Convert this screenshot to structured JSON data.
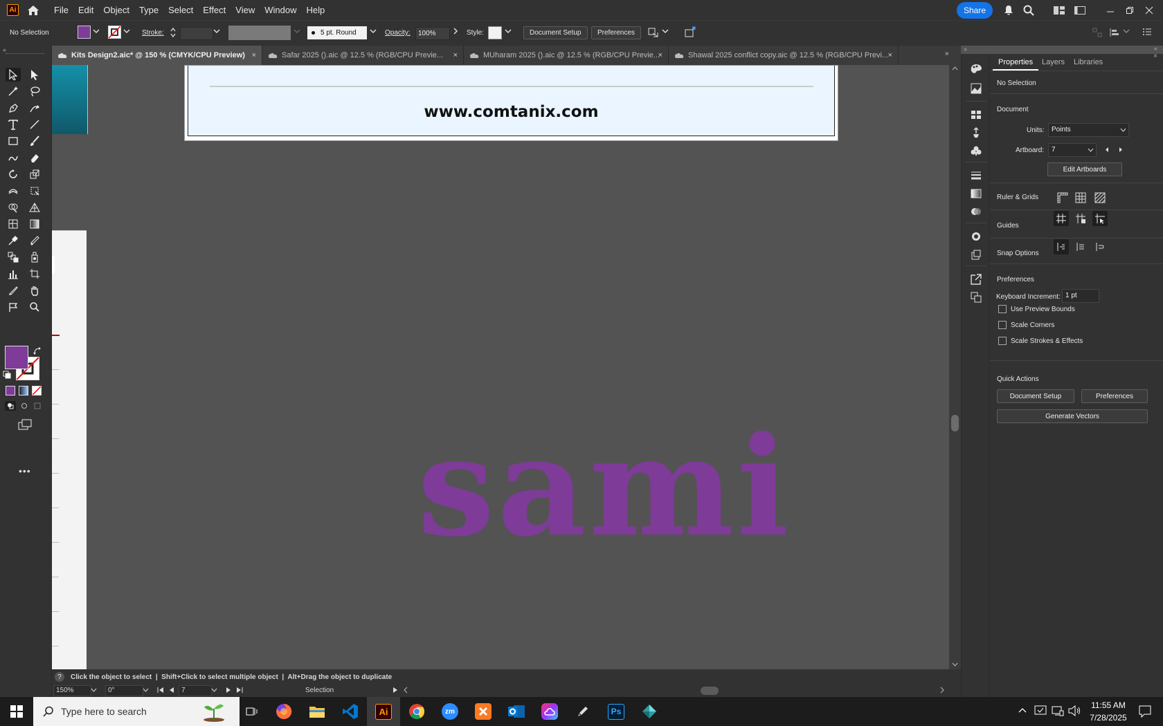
{
  "menubar": {
    "app_badge": "Ai",
    "items": [
      "File",
      "Edit",
      "Object",
      "Type",
      "Select",
      "Effect",
      "View",
      "Window",
      "Help"
    ],
    "share_label": "Share"
  },
  "control": {
    "selection_status": "No Selection",
    "stroke_label": "Stroke:",
    "brush_value": "5 pt. Round",
    "opacity_label": "Opacity:",
    "opacity_value": "100%",
    "style_label": "Style:",
    "document_setup": "Document Setup",
    "preferences": "Preferences",
    "fill_color": "#7e3b98"
  },
  "tabs": [
    {
      "label": "Kits Design2.aic* @ 150 % (CMYK/CPU Preview)",
      "close": "×"
    },
    {
      "label": "Safar 2025 ().aic @ 12.5 % (RGB/CPU Previe...",
      "close": "×"
    },
    {
      "label": "MUharam 2025 ().aic @ 12.5 % (RGB/CPU Previe...",
      "close": "×"
    },
    {
      "label": "Shawal 2025 conflict copy.aic @ 12.5 % (RGB/CPU Previ...",
      "close": "×"
    }
  ],
  "canvas": {
    "website_text": "www.comtanix.com",
    "artwork_text": "sami",
    "artwork_color": "#7e3b98"
  },
  "status": {
    "hint": "Click the object to select  |  Shift+Click to select multiple object  |  Alt+Drag the object to duplicate",
    "zoom": "150%",
    "rotation": "0°",
    "artboard_num": "7",
    "tool_name": "Selection"
  },
  "properties": {
    "tabs": [
      "Properties",
      "Layers",
      "Libraries"
    ],
    "selection": "No Selection",
    "document_heading": "Document",
    "units_label": "Units:",
    "units_value": "Points",
    "artboard_label": "Artboard:",
    "artboard_value": "7",
    "edit_artboards": "Edit Artboards",
    "ruler_grids": "Ruler & Grids",
    "guides": "Guides",
    "snap_options": "Snap Options",
    "preferences_heading": "Preferences",
    "keyboard_increment_label": "Keyboard Increment:",
    "keyboard_increment_value": "1 pt",
    "use_preview_bounds": "Use Preview Bounds",
    "scale_corners": "Scale Corners",
    "scale_strokes": "Scale Strokes & Effects",
    "quick_actions": "Quick Actions",
    "document_setup": "Document Setup",
    "preferences": "Preferences",
    "generate_vectors": "Generate Vectors"
  },
  "taskbar": {
    "search_placeholder": "Type here to search",
    "time": "11:55 AM",
    "date": "7/28/2025",
    "apps": [
      "task-view",
      "firefox",
      "file-explorer",
      "vscode",
      "illustrator",
      "chrome",
      "zoom",
      "xampp",
      "outlook",
      "creative-cloud",
      "pen-tool",
      "photoshop",
      "app"
    ]
  }
}
